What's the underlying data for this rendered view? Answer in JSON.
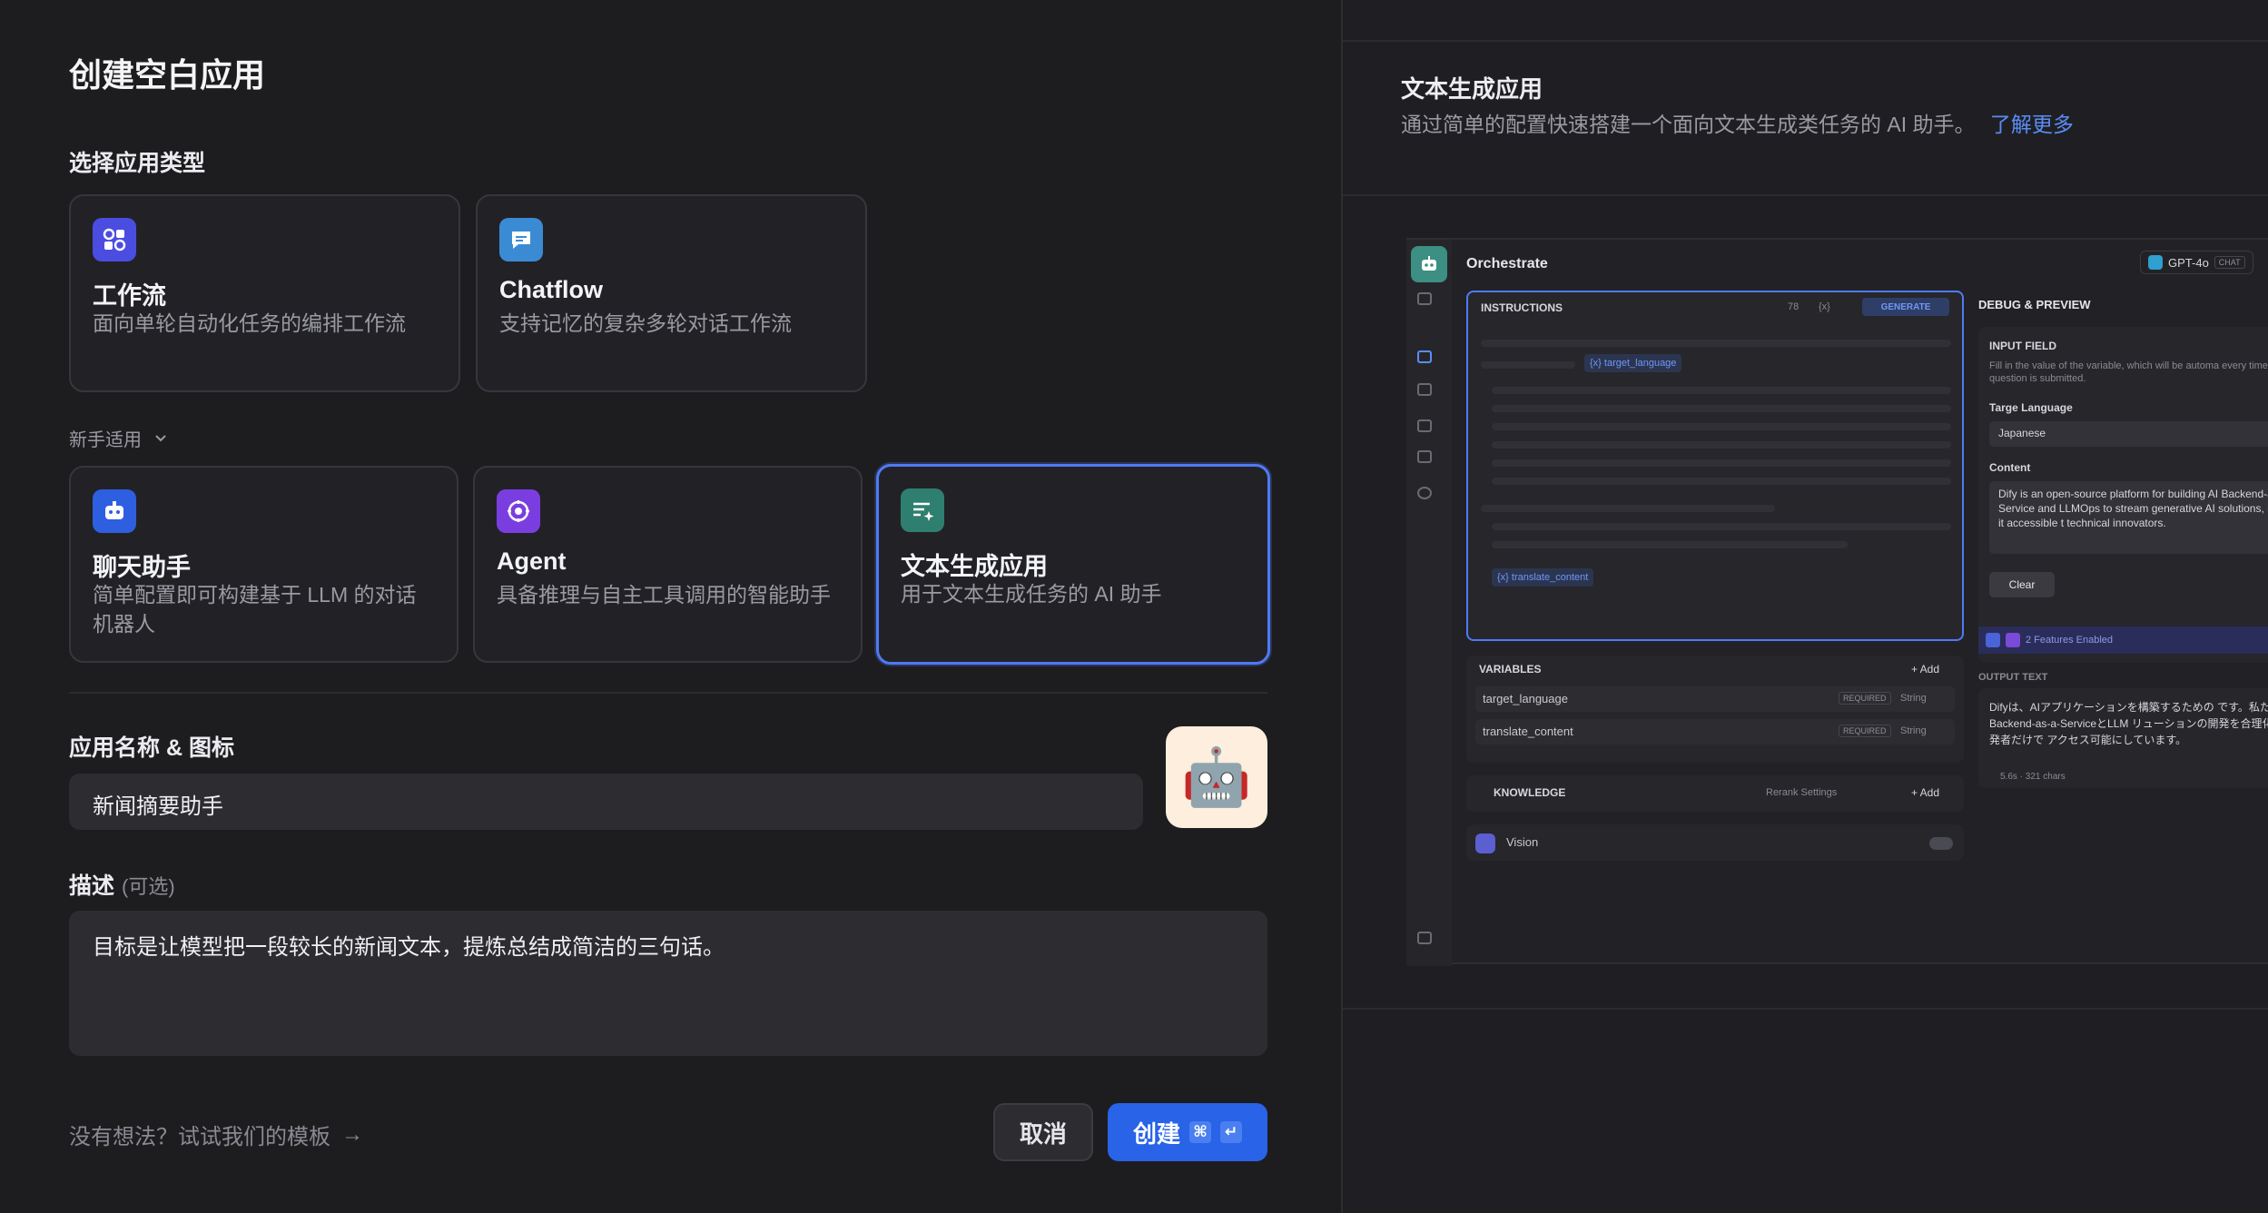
{
  "dialog": {
    "title": "创建空白应用",
    "type_section_label": "选择应用类型",
    "beginner_label": "新手适用",
    "types_main": [
      {
        "name": "工作流",
        "desc": "面向单轮自动化任务的编排工作流",
        "icon": "workflow-icon",
        "color": "#4a4de0"
      },
      {
        "name": "Chatflow",
        "desc": "支持记忆的复杂多轮对话工作流",
        "icon": "chatflow-icon",
        "color": "#3a8bd4"
      }
    ],
    "types_beginner": [
      {
        "name": "聊天助手",
        "desc": "简单配置即可构建基于 LLM 的对话机器人",
        "icon": "chat-assistant-icon",
        "color": "#2e5fe0"
      },
      {
        "name": "Agent",
        "desc": "具备推理与自主工具调用的智能助手",
        "icon": "agent-icon",
        "color": "#7a3ee0"
      },
      {
        "name": "文本生成应用",
        "desc": "用于文本生成任务的 AI 助手",
        "icon": "text-generator-icon",
        "color": "#2f7f70",
        "selected": true
      }
    ],
    "name_label": "应用名称 & 图标",
    "name_value": "新闻摘要助手",
    "app_icon": "robot-emoji",
    "app_icon_glyph": "🤖",
    "desc_label": "描述",
    "desc_optional": "(可选)",
    "desc_value": "目标是让模型把一段较长的新闻文本，提炼总结成简洁的三句话。",
    "template_link": "没有想法？试试我们的模板",
    "template_arrow": "→",
    "cancel_label": "取消",
    "create_label": "创建",
    "create_shortcut_cmd": "⌘",
    "create_shortcut_enter": "↵"
  },
  "preview": {
    "title": "文本生成应用",
    "subtitle": "通过简单的配置快速搭建一个面向文本生成类任务的 AI 助手。",
    "learn_more": "了解更多",
    "orchestrate": "Orchestrate",
    "model": "GPT-4o",
    "model_tag": "CHAT",
    "instructions_label": "INSTRUCTIONS",
    "instructions_count": "78",
    "var_symbol": "{x}",
    "generate": "GENERATE",
    "var_target": "{x} target_language",
    "var_content": "{x} translate_content",
    "variables_label": "VARIABLES",
    "add": "+ Add",
    "variables": [
      {
        "name": "target_language",
        "required": "REQUIRED",
        "type": "String"
      },
      {
        "name": "translate_content",
        "required": "REQUIRED",
        "type": "String"
      }
    ],
    "knowledge_label": "KNOWLEDGE",
    "rerank": "Rerank Settings",
    "vision_label": "Vision",
    "debug_label": "DEBUG & PREVIEW",
    "input_field_label": "INPUT FIELD",
    "input_field_hint": "Fill in the value of the variable, which will be automa every time a question is submitted.",
    "targe_language_label": "Targe Language",
    "targe_language_value": "Japanese",
    "content_label": "Content",
    "content_value": "Dify is an open-source platform for building AI Backend-as-a-Service and LLMOps to stream generative AI solutions, making it accessible t technical innovators.",
    "clear": "Clear",
    "features": "2 Features Enabled",
    "output_label": "OUTPUT TEXT",
    "output_value": "Difyは、AIアプリケーションを構築するための です。私たちは、Backend-as-a-ServiceとLLM リューションの開発を合理化し、開発者だけで アクセス可能にしています。",
    "output_meta": "5.6s · 321 chars"
  }
}
